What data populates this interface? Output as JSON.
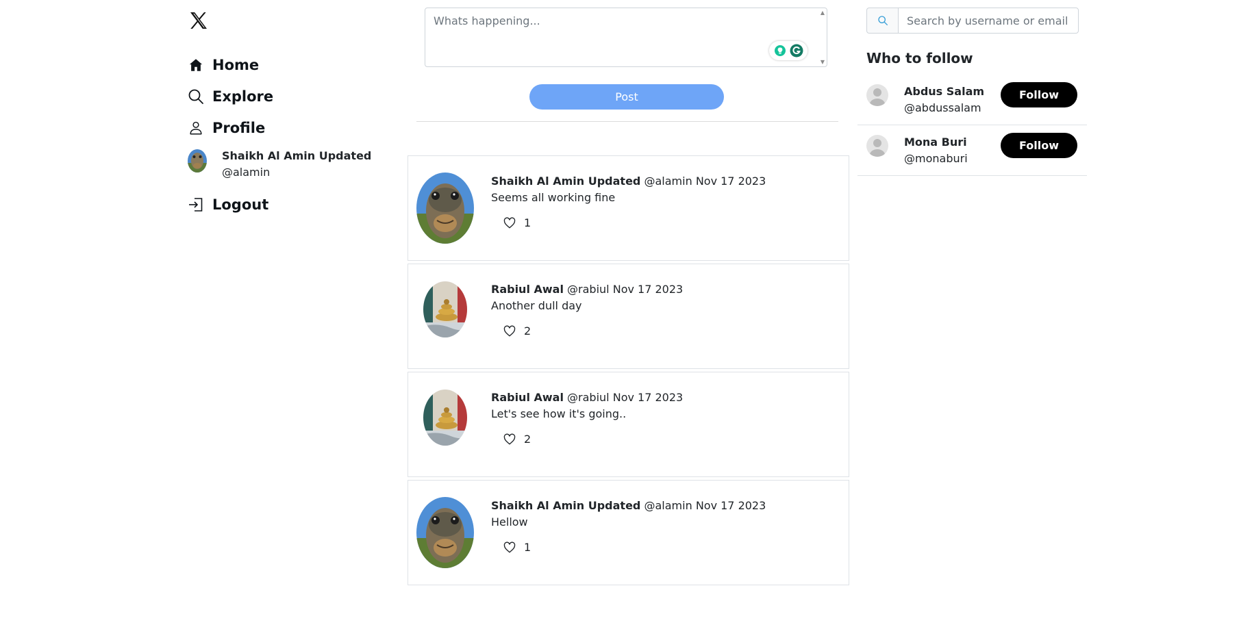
{
  "sidebar": {
    "logo_icon": "x-logo-icon",
    "nav": [
      {
        "label": "Home",
        "icon": "home-icon"
      },
      {
        "label": "Explore",
        "icon": "search-icon"
      },
      {
        "label": "Profile",
        "icon": "person-icon"
      }
    ],
    "current_user": {
      "name": "Shaikh Al Amin Updated",
      "handle": "@alamin"
    },
    "logout": {
      "label": "Logout",
      "icon": "logout-icon"
    }
  },
  "composer": {
    "placeholder": "Whats happening...",
    "post_label": "Post",
    "post_color": "#6ea5f7"
  },
  "feed": [
    {
      "author": "Shaikh Al Amin Updated",
      "handle": "@alamin",
      "date": "Nov 17 2023",
      "text": "Seems all working fine",
      "likes": "1",
      "avatar": "snake-closeup"
    },
    {
      "author": "Rabiul Awal",
      "handle": "@rabiul",
      "date": "Nov 17 2023",
      "text": "Another dull day",
      "likes": "2",
      "avatar": "snake-coiled"
    },
    {
      "author": "Rabiul Awal",
      "handle": "@rabiul",
      "date": "Nov 17 2023",
      "text": "Let's see how it's going..",
      "likes": "2",
      "avatar": "snake-coiled"
    },
    {
      "author": "Shaikh Al Amin Updated",
      "handle": "@alamin",
      "date": "Nov 17 2023",
      "text": "Hellow",
      "likes": "1",
      "avatar": "snake-closeup"
    }
  ],
  "search": {
    "placeholder": "Search by username or email ...",
    "icon": "search-icon"
  },
  "who_to_follow": {
    "title": "Who to follow",
    "button_label": "Follow",
    "users": [
      {
        "name": "Abdus Salam",
        "handle": "@abdussalam"
      },
      {
        "name": "Mona Buri",
        "handle": "@monaburi"
      }
    ]
  }
}
